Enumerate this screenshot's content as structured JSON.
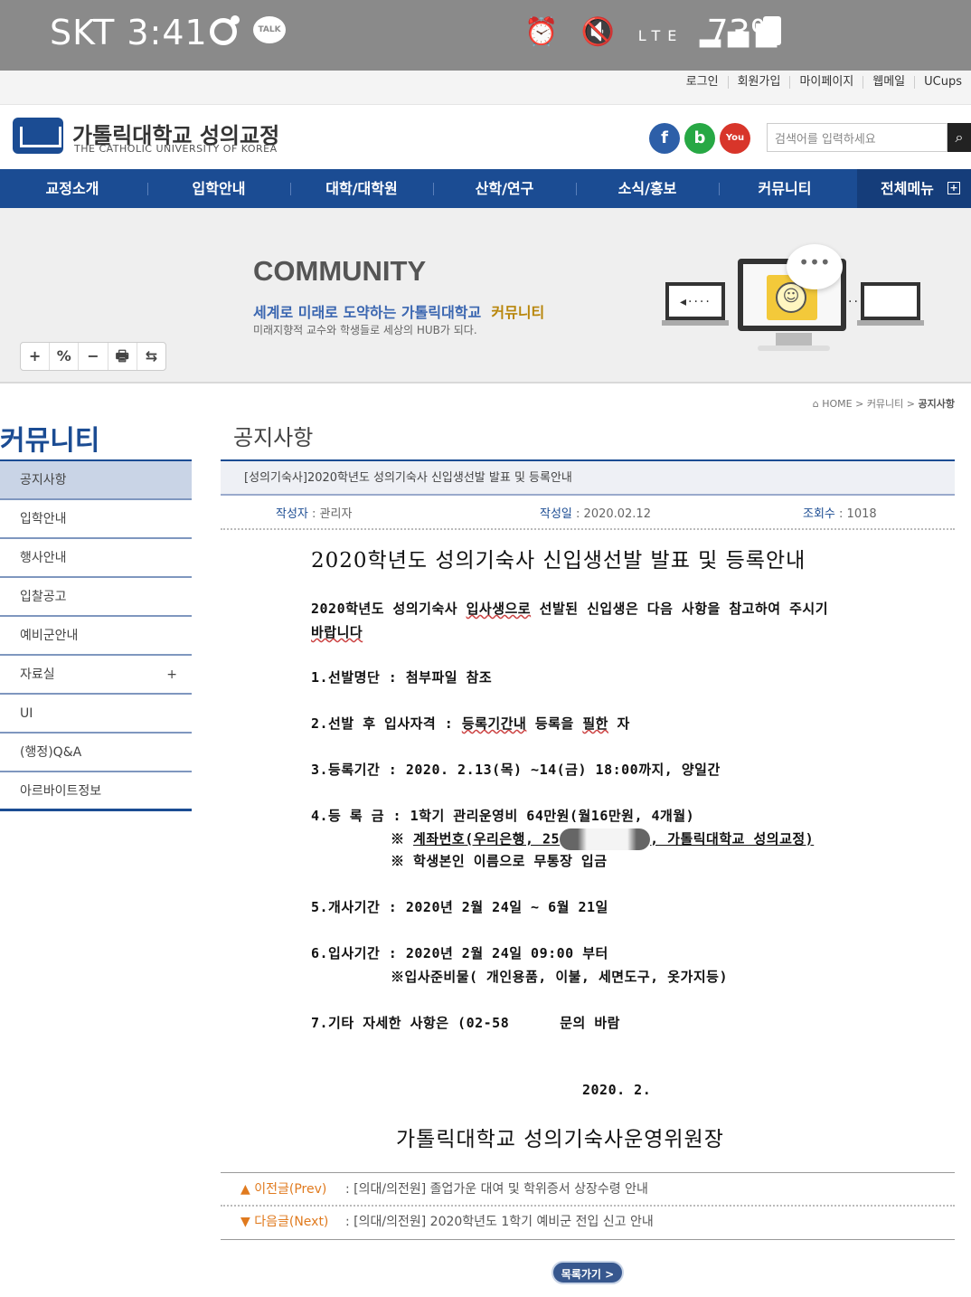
{
  "status": {
    "carrier_time": "SKT 3:41",
    "talk": "TALK",
    "lte": "LTE",
    "battery": "73%"
  },
  "util": [
    "로그인",
    "회원가입",
    "마이페이지",
    "웹메일",
    "UCups"
  ],
  "header": {
    "logo_kr": "가톨릭대학교 성의교정",
    "logo_en": "THE CATHOLIC UNIVERSITY OF KOREA",
    "sns_fb": "f",
    "sns_blog": "b",
    "sns_yt": "You Tube",
    "search_placeholder": "검색어를 입력하세요"
  },
  "nav": {
    "items": [
      "교정소개",
      "입학안내",
      "대학/대학원",
      "산학/연구",
      "소식/홍보",
      "커뮤니티"
    ],
    "all": "전체메뉴",
    "all_plus": "+"
  },
  "banner": {
    "title": "COMMUNITY",
    "sub1_a": "세계로 미래로 도약하는 가톨릭대학교",
    "sub1_b": "커뮤니티",
    "sub2": "미래지향적 교수와 학생들로 세상의 HUB가 되다."
  },
  "tools": [
    "+",
    "%",
    "−",
    "🖶",
    "⇆"
  ],
  "breadcrumb": {
    "home": "HOME > 커뮤니티 > ",
    "current": "공지사항"
  },
  "sidebar": {
    "title": "커뮤니티",
    "items": [
      "공지사항",
      "입학안내",
      "행사안내",
      "입찰공고",
      "예비군안내",
      "자료실",
      "UI",
      "(행정)Q&A",
      "아르바이트정보"
    ],
    "more": "+"
  },
  "content": {
    "title": "공지사항",
    "post_title": "[성의기숙사]2020학년도 성의기숙사 신입생선발 발표 및 등록안내",
    "author_label": "작성자",
    "author": ": 관리자",
    "date_label": "작성일",
    "date": ": 2020.02.12",
    "views_label": "조회수",
    "views": ": 1018"
  },
  "doc": {
    "title": "2020학년도 성의기숙사 신입생선발 발표 및 등록안내",
    "intro1a": "2020학년도 성의기숙사 ",
    "intro1b": "입사생으로",
    "intro1c": " 선발된 신입생은 다음 사항을 참고하여 주시기",
    "intro2": "바랍니다",
    "l1": "1.선발명단 : 첨부파일 참조",
    "l2a": "2.선발 후 입사자격 : ",
    "l2b": "등록기간내",
    "l2c": " 등록을 ",
    "l2d": "필한",
    "l2e": " 자",
    "l3": "3.등록기간 : 2020. 2.13(목) ~14(금) 18:00까지, 양일간",
    "l4": "4.등 록 금 : 1학기 관리운영비 64만원(월16만원, 4개월)",
    "l4b_a": "※ ",
    "l4b_b": "계좌번호(우리은행, 25",
    "l4b_c": ", 가톨릭대학교 성의교정)",
    "l4c": "※ 학생본인 이름으로 무통장 입금",
    "l5": "5.개사기간 : 2020년 2월 24일 ~ 6월 21일",
    "l6": "6.입사기간 : 2020년 2월 24일 09:00 부터",
    "l6b": "※입사준비물( 개인용품, 이불, 세면도구, 옷가지등)",
    "l7a": "7.기타 자세한 사항은 (02-58",
    "l7b": "문의 바람",
    "date_line": "2020.     2.",
    "sign": "가톨릭대학교 성의기숙사운영위원장"
  },
  "prev": {
    "label": "▲ 이전글(Prev)",
    "title": ": [의대/의전원] 졸업가운 대여 및 학위증서 상장수령 안내"
  },
  "next": {
    "label": "▼ 다음글(Next)",
    "title": ": [의대/의전원] 2020학년도 1학기 예비군 전입 신고 안내"
  },
  "list_button": "목록가기 >"
}
